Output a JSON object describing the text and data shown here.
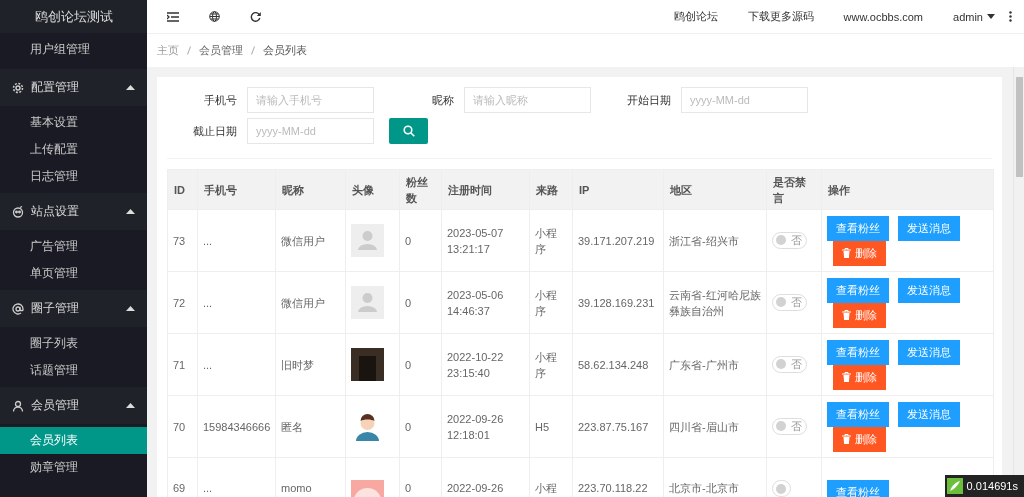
{
  "sidebar": {
    "title": "鸥创论坛测试",
    "menu": [
      {
        "kind": "item",
        "label": "用户组管理",
        "selected": false
      },
      {
        "kind": "group",
        "label": "配置管理",
        "expanded": true,
        "children": [
          {
            "label": "基本设置",
            "selected": false
          },
          {
            "label": "上传配置",
            "selected": false
          },
          {
            "label": "日志管理",
            "selected": false
          }
        ]
      },
      {
        "kind": "group",
        "label": "站点设置",
        "expanded": true,
        "children": [
          {
            "label": "广告管理",
            "selected": false
          },
          {
            "label": "单页管理",
            "selected": false
          }
        ]
      },
      {
        "kind": "group",
        "label": "圈子管理",
        "expanded": true,
        "children": [
          {
            "label": "圈子列表",
            "selected": false
          },
          {
            "label": "话题管理",
            "selected": false
          }
        ]
      },
      {
        "kind": "group",
        "label": "会员管理",
        "expanded": true,
        "children": [
          {
            "label": "会员列表",
            "selected": true
          },
          {
            "label": "勋章管理",
            "selected": false
          }
        ]
      }
    ]
  },
  "header": {
    "links": [
      "鸥创论坛",
      "下载更多源码",
      "www.ocbbs.com"
    ],
    "user": "admin"
  },
  "breadcrumb": [
    "主页",
    "会员管理",
    "会员列表"
  ],
  "filters": [
    {
      "label": "手机号",
      "placeholder": "请输入手机号"
    },
    {
      "label": "昵称",
      "placeholder": "请输入昵称"
    },
    {
      "label": "开始日期",
      "placeholder": "yyyy-MM-dd"
    },
    {
      "label": "截止日期",
      "placeholder": "yyyy-MM-dd"
    }
  ],
  "table": {
    "columns": [
      "ID",
      "手机号",
      "昵称",
      "头像",
      "粉丝数",
      "注册时间",
      "来路",
      "IP",
      "地区",
      "是否禁言",
      "操作"
    ],
    "rows": [
      {
        "id": "73",
        "phone": "...",
        "nickname": "微信用户",
        "avatar": {
          "kind": "placeholder"
        },
        "fans": "0",
        "time": [
          "2023-05-07",
          "13:21:17"
        ],
        "source": "小程序",
        "ip": "39.171.207.219",
        "region": "浙江省-绍兴市",
        "muted": false,
        "mute_label": "否",
        "actions": [
          "查看粉丝",
          "发送消息",
          "删除"
        ]
      },
      {
        "id": "72",
        "phone": "...",
        "nickname": "微信用户",
        "avatar": {
          "kind": "placeholder"
        },
        "fans": "0",
        "time": [
          "2023-05-06",
          "14:46:37"
        ],
        "source": "小程序",
        "ip": "39.128.169.231",
        "region": "云南省-红河哈尼族彝族自治州",
        "muted": false,
        "mute_label": "否",
        "actions": [
          "查看粉丝",
          "发送消息",
          "删除"
        ]
      },
      {
        "id": "71",
        "phone": "...",
        "nickname": "旧时梦",
        "avatar": {
          "kind": "photo"
        },
        "fans": "0",
        "time": [
          "2022-10-22",
          "23:15:40"
        ],
        "source": "小程序",
        "ip": "58.62.134.248",
        "region": "广东省-广州市",
        "muted": false,
        "mute_label": "否",
        "actions": [
          "查看粉丝",
          "发送消息",
          "删除"
        ]
      },
      {
        "id": "70",
        "phone": "15984346666",
        "nickname": "匿名",
        "avatar": {
          "kind": "cartoon"
        },
        "fans": "0",
        "time": [
          "2022-09-26",
          "12:18:01"
        ],
        "source": "H5",
        "ip": "223.87.75.167",
        "region": "四川省-眉山市",
        "muted": false,
        "mute_label": "否",
        "actions": [
          "查看粉丝",
          "发送消息",
          "删除"
        ]
      },
      {
        "id": "69",
        "phone": "...",
        "nickname": "momo",
        "avatar": {
          "kind": "pink"
        },
        "fans": "0",
        "time": [
          "2022-09-26"
        ],
        "source": "小程",
        "ip": "223.70.118.22",
        "region": "北京市-北京市",
        "muted": false,
        "actions": [
          "查看粉丝"
        ]
      }
    ]
  },
  "trace_badge": "0.014691s"
}
